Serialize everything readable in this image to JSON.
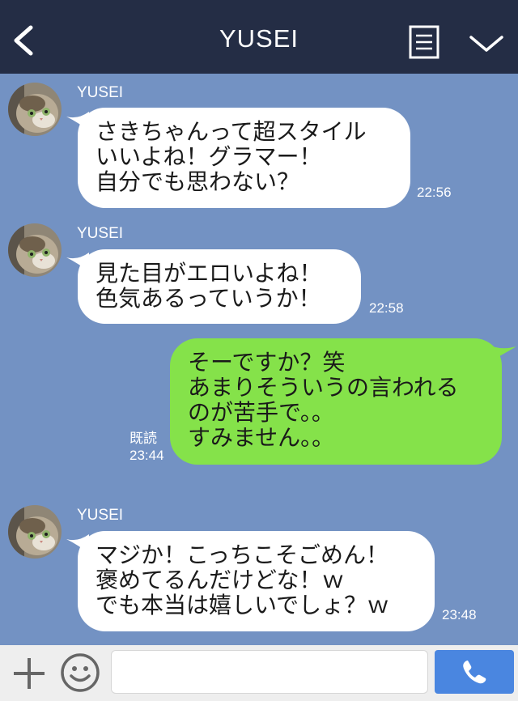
{
  "header": {
    "title": "YUSEI",
    "back_icon": "chevron-left-icon",
    "menu_icon": "list-icon",
    "collapse_icon": "chevron-down-icon"
  },
  "messages": [
    {
      "sender": "YUSEI",
      "lines": [
        "さきちゃんって超スタイル",
        "いいよね！グラマー！",
        "自分でも思わない？"
      ],
      "time": "22:56"
    },
    {
      "sender": "YUSEI",
      "lines": [
        "見た目がエロいよね！",
        "色気あるっていうか！"
      ],
      "time": "22:58"
    },
    {
      "sender": "me",
      "lines": [
        "そーですか？笑",
        "あまりそういうの言われる",
        "のが苦手で。。",
        "すみません。。"
      ],
      "read": "既読",
      "time": "23:44"
    },
    {
      "sender": "YUSEI",
      "lines": [
        "マジか！こっちこそごめん！",
        "褒めてるんだけどな！ｗ",
        "でも本当は嬉しいでしょ？ｗ"
      ],
      "time": "23:48"
    }
  ],
  "footer": {
    "input_value": "",
    "plus_icon": "plus-icon",
    "sticker_icon": "smile-icon",
    "call_icon": "phone-icon"
  },
  "colors": {
    "header_bg": "#242d45",
    "chat_bg": "#7392c3",
    "outgoing_bubble": "#85e24a",
    "incoming_bubble": "#ffffff",
    "call_button": "#4a86e0"
  }
}
